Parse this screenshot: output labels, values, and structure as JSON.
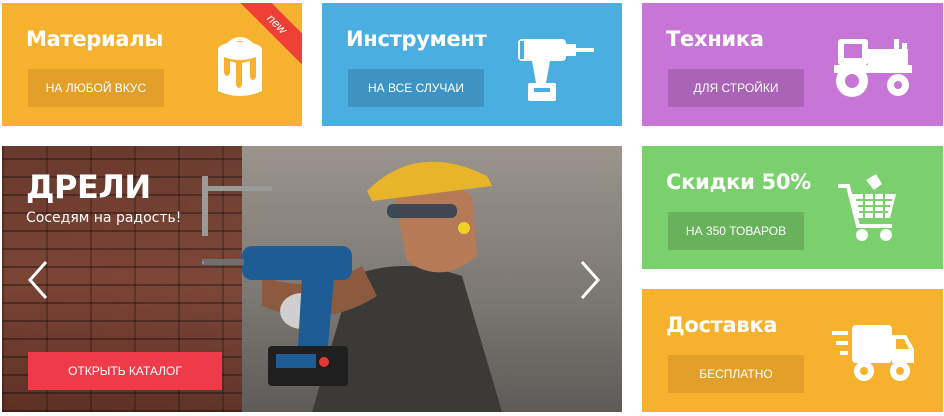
{
  "tiles": {
    "materials": {
      "title": "Материалы",
      "button": "НА ЛЮБОЙ ВКУС",
      "badge": "new",
      "color": "#f6b22f",
      "icon": "paint-bucket-icon"
    },
    "tools": {
      "title": "Инструмент",
      "button": "НА ВСЕ СЛУЧАИ",
      "color": "#4aaee0",
      "icon": "drill-icon"
    },
    "machinery": {
      "title": "Техника",
      "button": "ДЛЯ СТРОЙКИ",
      "color": "#c775d6",
      "icon": "tractor-icon"
    },
    "discounts": {
      "title": "Скидки 50%",
      "button": "НА 350 ТОВАРОВ",
      "color": "#7bd06e",
      "icon": "shopping-cart-icon"
    },
    "delivery": {
      "title": "Доставка",
      "button": "БЕСПЛАТНО",
      "color": "#f6b22f",
      "icon": "delivery-truck-icon"
    }
  },
  "hero": {
    "title": "ДРЕЛИ",
    "subtitle": "Соседям на радость!",
    "cta": "ОТКРЫТЬ КАТАЛОГ",
    "cta_color": "#ef3b49",
    "prev_icon": "chevron-left-icon",
    "next_icon": "chevron-right-icon"
  }
}
